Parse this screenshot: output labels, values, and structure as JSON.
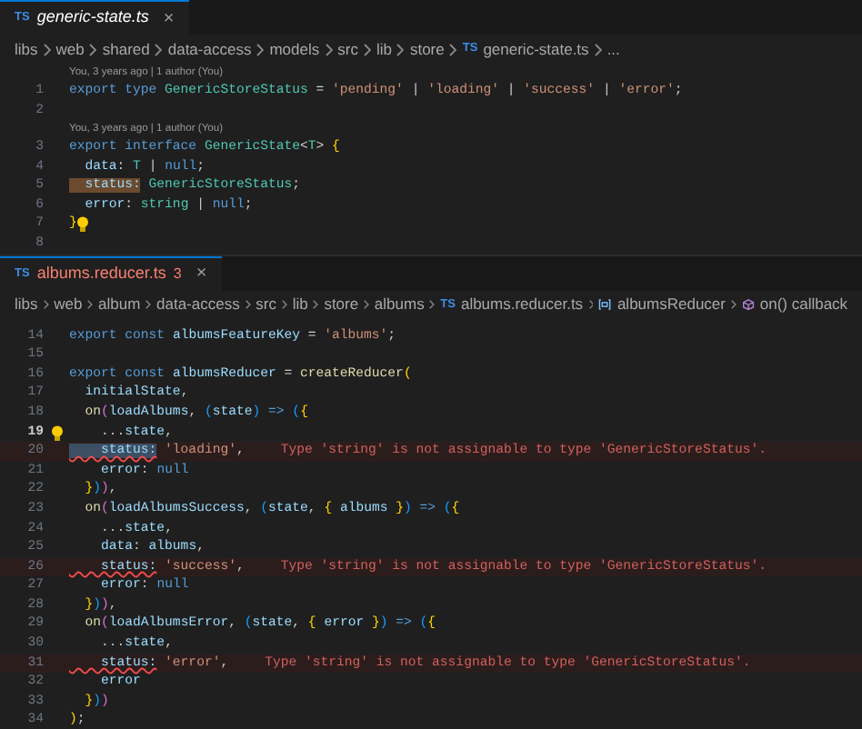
{
  "editors": [
    {
      "tab": {
        "label": "generic-state.ts",
        "preview": true,
        "errors": false,
        "icon": "TS",
        "close": "×"
      },
      "breadcrumb": [
        {
          "text": "libs"
        },
        {
          "text": "web"
        },
        {
          "text": "shared"
        },
        {
          "text": "data-access"
        },
        {
          "text": "models"
        },
        {
          "text": "src"
        },
        {
          "text": "lib"
        },
        {
          "text": "store"
        },
        {
          "text": "generic-state.ts",
          "icon": "TS"
        },
        {
          "text": "..."
        }
      ],
      "lines": [
        {
          "codelens": "You, 3 years ago | 1 author (You)"
        },
        {
          "n": "1",
          "current": false,
          "tokens": [
            {
              "kind": "keyword",
              "text": "export type "
            },
            {
              "kind": "type",
              "text": "GenericStoreStatus"
            },
            {
              "kind": "plain",
              "text": " = "
            },
            {
              "kind": "string",
              "text": "'pending'"
            },
            {
              "kind": "plain",
              "text": " | "
            },
            {
              "kind": "string",
              "text": "'loading'"
            },
            {
              "kind": "plain",
              "text": " | "
            },
            {
              "kind": "string",
              "text": "'success'"
            },
            {
              "kind": "plain",
              "text": " | "
            },
            {
              "kind": "string",
              "text": "'error'"
            },
            {
              "kind": "plain",
              "text": ";"
            }
          ]
        },
        {
          "n": "2",
          "current": false
        },
        {
          "codelens": "You, 3 years ago | 1 author (You)"
        },
        {
          "n": "3",
          "current": false,
          "tokens": [
            {
              "kind": "keyword",
              "text": "export interface "
            },
            {
              "kind": "type",
              "text": "GenericState"
            },
            {
              "kind": "plain",
              "text": "<"
            },
            {
              "kind": "type",
              "text": "T"
            },
            {
              "kind": "plain",
              "text": "> "
            },
            {
              "kind": "brace",
              "text": "{"
            }
          ]
        },
        {
          "n": "4",
          "current": false,
          "tokens": [
            {
              "kind": "variable",
              "text": "  data"
            },
            {
              "kind": "plain",
              "text": ": "
            },
            {
              "kind": "type",
              "text": "T"
            },
            {
              "kind": "plain",
              "text": " | "
            },
            {
              "kind": "keyword",
              "text": "null"
            },
            {
              "kind": "plain",
              "text": ";"
            }
          ]
        },
        {
          "n": "5",
          "current": false,
          "tokens": [
            {
              "kind": "occurrence",
              "text": "  status:"
            },
            {
              "kind": "type",
              "text": " GenericStoreStatus"
            },
            {
              "kind": "plain",
              "text": ";"
            }
          ]
        },
        {
          "n": "6",
          "current": false,
          "tokens": [
            {
              "kind": "variable",
              "text": "  error"
            },
            {
              "kind": "plain",
              "text": ": "
            },
            {
              "kind": "type",
              "text": "string"
            },
            {
              "kind": "plain",
              "text": " | "
            },
            {
              "kind": "keyword",
              "text": "null"
            },
            {
              "kind": "plain",
              "text": ";"
            }
          ]
        },
        {
          "n": "7",
          "current": false,
          "lightbulb": {
            "kind": "inline"
          },
          "tokens": [
            {
              "kind": "brace",
              "text": "}"
            }
          ]
        },
        {
          "n": "8",
          "current": false
        }
      ]
    },
    {
      "tab": {
        "label": "albums.reducer.ts",
        "badge": "3",
        "preview": false,
        "errors": true,
        "icon": "TS",
        "close": "×"
      },
      "breadcrumb": [
        {
          "text": "libs"
        },
        {
          "text": "web"
        },
        {
          "text": "album"
        },
        {
          "text": "data-access"
        },
        {
          "text": "src"
        },
        {
          "text": "lib"
        },
        {
          "text": "store"
        },
        {
          "text": "albums"
        },
        {
          "text": "albums.reducer.ts",
          "icon": "TS"
        },
        {
          "text": "albumsReducer",
          "kind": "variable"
        },
        {
          "text": "on() callback",
          "kind": "method"
        }
      ],
      "lines": [
        {
          "n": "14",
          "current": false,
          "tokens": [
            {
              "kind": "keyword",
              "text": "export const "
            },
            {
              "kind": "variable",
              "text": "albumsFeatureKey"
            },
            {
              "kind": "plain",
              "text": " = "
            },
            {
              "kind": "string",
              "text": "'albums'"
            },
            {
              "kind": "plain",
              "text": ";"
            }
          ]
        },
        {
          "n": "15",
          "current": false
        },
        {
          "n": "16",
          "current": false,
          "tokens": [
            {
              "kind": "keyword",
              "text": "export const "
            },
            {
              "kind": "variable",
              "text": "albumsReducer"
            },
            {
              "kind": "plain",
              "text": " = "
            },
            {
              "kind": "function",
              "text": "createReducer"
            },
            {
              "kind": "brace",
              "text": "("
            }
          ]
        },
        {
          "n": "17",
          "current": false,
          "tokens": [
            {
              "kind": "variable",
              "text": "  initialState"
            },
            {
              "kind": "plain",
              "text": ","
            }
          ]
        },
        {
          "n": "18",
          "current": false,
          "tokens": [
            {
              "kind": "function",
              "text": "  on"
            },
            {
              "kind": "brace2",
              "text": "("
            },
            {
              "kind": "variable",
              "text": "loadAlbums"
            },
            {
              "kind": "plain",
              "text": ", "
            },
            {
              "kind": "brace3",
              "text": "("
            },
            {
              "kind": "variable",
              "text": "state"
            },
            {
              "kind": "brace3",
              "text": ")"
            },
            {
              "kind": "keyword",
              "text": " => "
            },
            {
              "kind": "brace3",
              "text": "("
            },
            {
              "kind": "brace",
              "text": "{"
            }
          ]
        },
        {
          "n": "19",
          "current": true,
          "lightbulb": {
            "kind": "gutter"
          },
          "tokens": [
            {
              "kind": "plain",
              "text": "    ..."
            },
            {
              "kind": "variable",
              "text": "state"
            },
            {
              "kind": "plain",
              "text": ","
            }
          ]
        },
        {
          "n": "20",
          "current": false,
          "diagnostic": "Type 'string' is not assignable to type 'GenericStoreStatus'.",
          "tokens": [
            {
              "kind": "selected",
              "text": "    status:"
            },
            {
              "kind": "string",
              "text": " 'loading'"
            },
            {
              "kind": "plain",
              "text": ","
            }
          ]
        },
        {
          "n": "21",
          "current": false,
          "tokens": [
            {
              "kind": "variable",
              "text": "    error"
            },
            {
              "kind": "plain",
              "text": ": "
            },
            {
              "kind": "keyword",
              "text": "null"
            }
          ]
        },
        {
          "n": "22",
          "current": false,
          "tokens": [
            {
              "kind": "brace",
              "text": "  }"
            },
            {
              "kind": "brace3",
              "text": ")"
            },
            {
              "kind": "brace2",
              "text": ")"
            },
            {
              "kind": "plain",
              "text": ","
            }
          ]
        },
        {
          "n": "23",
          "current": false,
          "tokens": [
            {
              "kind": "function",
              "text": "  on"
            },
            {
              "kind": "brace2",
              "text": "("
            },
            {
              "kind": "variable",
              "text": "loadAlbumsSuccess"
            },
            {
              "kind": "plain",
              "text": ", "
            },
            {
              "kind": "brace3",
              "text": "("
            },
            {
              "kind": "variable",
              "text": "state"
            },
            {
              "kind": "plain",
              "text": ", "
            },
            {
              "kind": "brace",
              "text": "{"
            },
            {
              "kind": "variable",
              "text": " albums "
            },
            {
              "kind": "brace",
              "text": "}"
            },
            {
              "kind": "brace3",
              "text": ")"
            },
            {
              "kind": "keyword",
              "text": " => "
            },
            {
              "kind": "brace3",
              "text": "("
            },
            {
              "kind": "brace",
              "text": "{"
            }
          ]
        },
        {
          "n": "24",
          "current": false,
          "tokens": [
            {
              "kind": "plain",
              "text": "    ..."
            },
            {
              "kind": "variable",
              "text": "state"
            },
            {
              "kind": "plain",
              "text": ","
            }
          ]
        },
        {
          "n": "25",
          "current": false,
          "tokens": [
            {
              "kind": "variable",
              "text": "    data"
            },
            {
              "kind": "plain",
              "text": ": "
            },
            {
              "kind": "variable",
              "text": "albums"
            },
            {
              "kind": "plain",
              "text": ","
            }
          ]
        },
        {
          "n": "26",
          "current": false,
          "diagnostic": "Type 'string' is not assignable to type 'GenericStoreStatus'.",
          "tokens": [
            {
              "kind": "error",
              "text": "    status:"
            },
            {
              "kind": "string",
              "text": " 'success'"
            },
            {
              "kind": "plain",
              "text": ","
            }
          ]
        },
        {
          "n": "27",
          "current": false,
          "tokens": [
            {
              "kind": "variable",
              "text": "    error"
            },
            {
              "kind": "plain",
              "text": ": "
            },
            {
              "kind": "keyword",
              "text": "null"
            }
          ]
        },
        {
          "n": "28",
          "current": false,
          "tokens": [
            {
              "kind": "brace",
              "text": "  }"
            },
            {
              "kind": "brace3",
              "text": ")"
            },
            {
              "kind": "brace2",
              "text": ")"
            },
            {
              "kind": "plain",
              "text": ","
            }
          ]
        },
        {
          "n": "29",
          "current": false,
          "tokens": [
            {
              "kind": "function",
              "text": "  on"
            },
            {
              "kind": "brace2",
              "text": "("
            },
            {
              "kind": "variable",
              "text": "loadAlbumsError"
            },
            {
              "kind": "plain",
              "text": ", "
            },
            {
              "kind": "brace3",
              "text": "("
            },
            {
              "kind": "variable",
              "text": "state"
            },
            {
              "kind": "plain",
              "text": ", "
            },
            {
              "kind": "brace",
              "text": "{"
            },
            {
              "kind": "variable",
              "text": " error "
            },
            {
              "kind": "brace",
              "text": "}"
            },
            {
              "kind": "brace3",
              "text": ")"
            },
            {
              "kind": "keyword",
              "text": " => "
            },
            {
              "kind": "brace3",
              "text": "("
            },
            {
              "kind": "brace",
              "text": "{"
            }
          ]
        },
        {
          "n": "30",
          "current": false,
          "tokens": [
            {
              "kind": "plain",
              "text": "    ..."
            },
            {
              "kind": "variable",
              "text": "state"
            },
            {
              "kind": "plain",
              "text": ","
            }
          ]
        },
        {
          "n": "31",
          "current": false,
          "diagnostic": "Type 'string' is not assignable to type 'GenericStoreStatus'.",
          "tokens": [
            {
              "kind": "error",
              "text": "    status:"
            },
            {
              "kind": "string",
              "text": " 'error'"
            },
            {
              "kind": "plain",
              "text": ","
            }
          ]
        },
        {
          "n": "32",
          "current": false,
          "tokens": [
            {
              "kind": "variable",
              "text": "    error"
            }
          ]
        },
        {
          "n": "33",
          "current": false,
          "tokens": [
            {
              "kind": "brace",
              "text": "  }"
            },
            {
              "kind": "brace3",
              "text": ")"
            },
            {
              "kind": "brace2",
              "text": ")"
            }
          ]
        },
        {
          "n": "34",
          "current": false,
          "tokens": [
            {
              "kind": "brace",
              "text": ")"
            },
            {
              "kind": "plain",
              "text": ";"
            }
          ]
        }
      ]
    }
  ]
}
